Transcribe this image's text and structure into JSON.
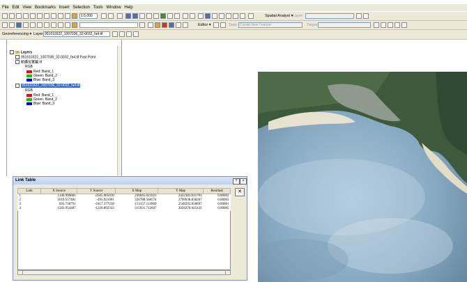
{
  "menu": [
    "File",
    "Edit",
    "View",
    "Bookmarks",
    "Insert",
    "Selection",
    "Tools",
    "Window",
    "Help"
  ],
  "toolbar": {
    "scale_value": "1:5,000",
    "spatial_analyst_label": "Spatial Analyst ▾",
    "layer_label": "Layer:",
    "editor_label": "Editor ▾",
    "task_label": "Task:",
    "task_value": "Create New Feature",
    "target_label": "Target:",
    "georef_label": "Georeferencing ▾",
    "georef_layer_label": "Layer:",
    "georef_layer_value": "951610322_1007036_32-0032_fa4.tif"
  },
  "toc": {
    "root_label": "Layers",
    "layer1_label": "951610322_1007036_32-0032_fa4.tif Fast Point",
    "group_label": "航攝位置圖.tif",
    "rgb1": "RGB",
    "band_red1": "Red:   Band_1",
    "band_green1": "Green: Band_2",
    "band_blue1": "Blue:  Band_3",
    "layer2_label": "951610322_1007036_32-0032_fa4.tif",
    "rgb2": "RGB",
    "band_red2": "Red:   Band_1",
    "band_green2": "Green: Band_2",
    "band_blue2": "Blue:  Band_3"
  },
  "link_table": {
    "title": "Link Table",
    "help_btn": "?",
    "close_btn": "×",
    "delete_btn": "✕",
    "columns": [
      "Link",
      "X Source",
      "Y Source",
      "X Map",
      "Y Map",
      "Residual"
    ],
    "rows": [
      [
        "1",
        "1146.996881",
        "-2505.985018",
        "236045.021023",
        "2422383.031703",
        "0.00002"
      ],
      [
        "2",
        "1610.557481",
        "-495.921091",
        "320788.568574",
        "2799938.838267",
        "0.00003"
      ],
      [
        "3",
        "693.738791",
        "-1817.377258",
        "153157.114969",
        "2548293.958697",
        "0.00001"
      ],
      [
        "4",
        "1583.954487",
        "-1226.892333",
        "315931.712607",
        "2656276.645431",
        "0.00005"
      ]
    ]
  },
  "colors": {
    "chrome": "#ece9d8",
    "title_bar": "#bcd0ee",
    "band_red": "#ff0000",
    "band_green": "#00cc00",
    "band_blue": "#0000ff",
    "layer_highlight": "#316ac5"
  }
}
